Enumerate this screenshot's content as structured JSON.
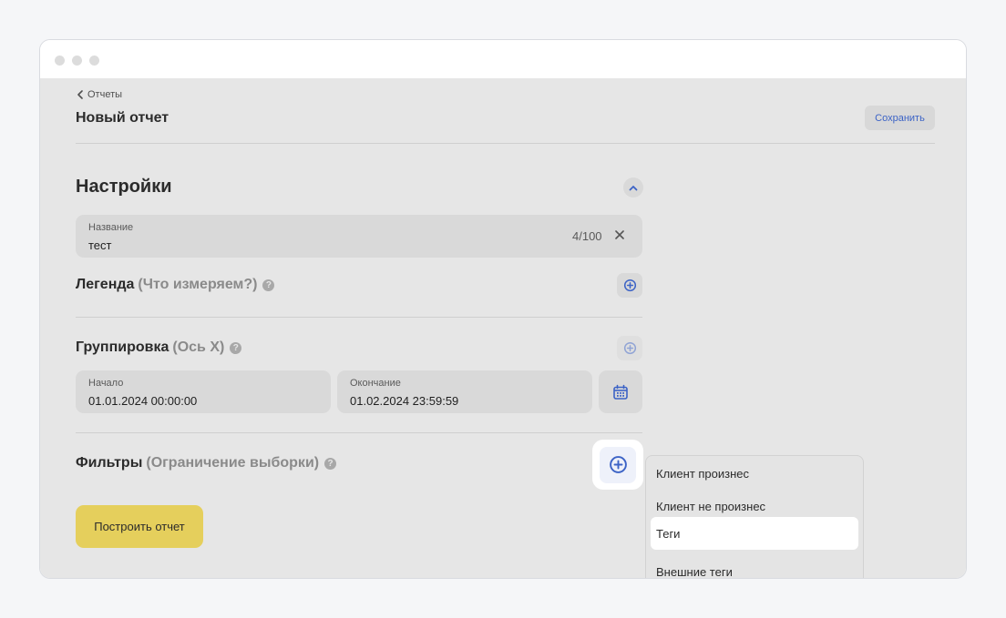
{
  "header": {
    "back_label": "Отчеты",
    "title": "Новый отчет",
    "save_label": "Сохранить"
  },
  "settings": {
    "title": "Настройки",
    "name_field": {
      "label": "Название",
      "value": "тест",
      "counter": "4/100"
    },
    "legend": {
      "title": "Легенда",
      "subtitle": "(Что измеряем?)"
    },
    "grouping": {
      "title": "Группировка",
      "subtitle": "(Ось X)",
      "start": {
        "label": "Начало",
        "value": "01.01.2024 00:00:00"
      },
      "end": {
        "label": "Окончание",
        "value": "01.02.2024 23:59:59"
      }
    },
    "filters": {
      "title": "Фильтры",
      "subtitle": "(Ограничение выборки)"
    },
    "build_label": "Построить отчет"
  },
  "dropdown": {
    "items": [
      "Клиент произнес",
      "Клиент не произнес",
      "Теги",
      "Внешние теги"
    ],
    "selected_index": 2
  },
  "colors": {
    "accent": "#3c63c6",
    "build_button": "#e5cf5c",
    "panel_bg": "#e6e6e6",
    "field_bg": "#d9d9d9"
  },
  "icons": {
    "back": "chevron-left-icon",
    "collapse": "chevron-up-icon",
    "clear": "close-icon",
    "help": "question-circle-icon",
    "add": "plus-circle-icon",
    "calendar": "calendar-icon"
  }
}
